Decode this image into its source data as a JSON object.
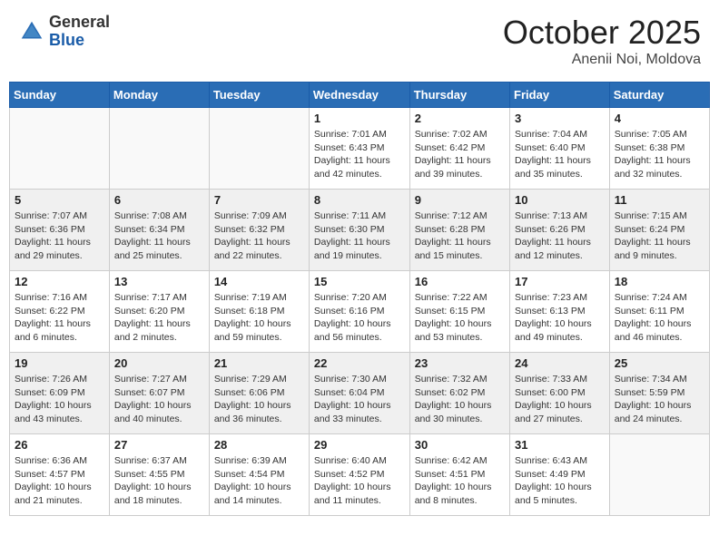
{
  "header": {
    "logo_general": "General",
    "logo_blue": "Blue",
    "month_title": "October 2025",
    "location": "Anenii Noi, Moldova"
  },
  "weekdays": [
    "Sunday",
    "Monday",
    "Tuesday",
    "Wednesday",
    "Thursday",
    "Friday",
    "Saturday"
  ],
  "weeks": [
    [
      {
        "day": "",
        "info": ""
      },
      {
        "day": "",
        "info": ""
      },
      {
        "day": "",
        "info": ""
      },
      {
        "day": "1",
        "info": "Sunrise: 7:01 AM\nSunset: 6:43 PM\nDaylight: 11 hours\nand 42 minutes."
      },
      {
        "day": "2",
        "info": "Sunrise: 7:02 AM\nSunset: 6:42 PM\nDaylight: 11 hours\nand 39 minutes."
      },
      {
        "day": "3",
        "info": "Sunrise: 7:04 AM\nSunset: 6:40 PM\nDaylight: 11 hours\nand 35 minutes."
      },
      {
        "day": "4",
        "info": "Sunrise: 7:05 AM\nSunset: 6:38 PM\nDaylight: 11 hours\nand 32 minutes."
      }
    ],
    [
      {
        "day": "5",
        "info": "Sunrise: 7:07 AM\nSunset: 6:36 PM\nDaylight: 11 hours\nand 29 minutes."
      },
      {
        "day": "6",
        "info": "Sunrise: 7:08 AM\nSunset: 6:34 PM\nDaylight: 11 hours\nand 25 minutes."
      },
      {
        "day": "7",
        "info": "Sunrise: 7:09 AM\nSunset: 6:32 PM\nDaylight: 11 hours\nand 22 minutes."
      },
      {
        "day": "8",
        "info": "Sunrise: 7:11 AM\nSunset: 6:30 PM\nDaylight: 11 hours\nand 19 minutes."
      },
      {
        "day": "9",
        "info": "Sunrise: 7:12 AM\nSunset: 6:28 PM\nDaylight: 11 hours\nand 15 minutes."
      },
      {
        "day": "10",
        "info": "Sunrise: 7:13 AM\nSunset: 6:26 PM\nDaylight: 11 hours\nand 12 minutes."
      },
      {
        "day": "11",
        "info": "Sunrise: 7:15 AM\nSunset: 6:24 PM\nDaylight: 11 hours\nand 9 minutes."
      }
    ],
    [
      {
        "day": "12",
        "info": "Sunrise: 7:16 AM\nSunset: 6:22 PM\nDaylight: 11 hours\nand 6 minutes."
      },
      {
        "day": "13",
        "info": "Sunrise: 7:17 AM\nSunset: 6:20 PM\nDaylight: 11 hours\nand 2 minutes."
      },
      {
        "day": "14",
        "info": "Sunrise: 7:19 AM\nSunset: 6:18 PM\nDaylight: 10 hours\nand 59 minutes."
      },
      {
        "day": "15",
        "info": "Sunrise: 7:20 AM\nSunset: 6:16 PM\nDaylight: 10 hours\nand 56 minutes."
      },
      {
        "day": "16",
        "info": "Sunrise: 7:22 AM\nSunset: 6:15 PM\nDaylight: 10 hours\nand 53 minutes."
      },
      {
        "day": "17",
        "info": "Sunrise: 7:23 AM\nSunset: 6:13 PM\nDaylight: 10 hours\nand 49 minutes."
      },
      {
        "day": "18",
        "info": "Sunrise: 7:24 AM\nSunset: 6:11 PM\nDaylight: 10 hours\nand 46 minutes."
      }
    ],
    [
      {
        "day": "19",
        "info": "Sunrise: 7:26 AM\nSunset: 6:09 PM\nDaylight: 10 hours\nand 43 minutes."
      },
      {
        "day": "20",
        "info": "Sunrise: 7:27 AM\nSunset: 6:07 PM\nDaylight: 10 hours\nand 40 minutes."
      },
      {
        "day": "21",
        "info": "Sunrise: 7:29 AM\nSunset: 6:06 PM\nDaylight: 10 hours\nand 36 minutes."
      },
      {
        "day": "22",
        "info": "Sunrise: 7:30 AM\nSunset: 6:04 PM\nDaylight: 10 hours\nand 33 minutes."
      },
      {
        "day": "23",
        "info": "Sunrise: 7:32 AM\nSunset: 6:02 PM\nDaylight: 10 hours\nand 30 minutes."
      },
      {
        "day": "24",
        "info": "Sunrise: 7:33 AM\nSunset: 6:00 PM\nDaylight: 10 hours\nand 27 minutes."
      },
      {
        "day": "25",
        "info": "Sunrise: 7:34 AM\nSunset: 5:59 PM\nDaylight: 10 hours\nand 24 minutes."
      }
    ],
    [
      {
        "day": "26",
        "info": "Sunrise: 6:36 AM\nSunset: 4:57 PM\nDaylight: 10 hours\nand 21 minutes."
      },
      {
        "day": "27",
        "info": "Sunrise: 6:37 AM\nSunset: 4:55 PM\nDaylight: 10 hours\nand 18 minutes."
      },
      {
        "day": "28",
        "info": "Sunrise: 6:39 AM\nSunset: 4:54 PM\nDaylight: 10 hours\nand 14 minutes."
      },
      {
        "day": "29",
        "info": "Sunrise: 6:40 AM\nSunset: 4:52 PM\nDaylight: 10 hours\nand 11 minutes."
      },
      {
        "day": "30",
        "info": "Sunrise: 6:42 AM\nSunset: 4:51 PM\nDaylight: 10 hours\nand 8 minutes."
      },
      {
        "day": "31",
        "info": "Sunrise: 6:43 AM\nSunset: 4:49 PM\nDaylight: 10 hours\nand 5 minutes."
      },
      {
        "day": "",
        "info": ""
      }
    ]
  ]
}
